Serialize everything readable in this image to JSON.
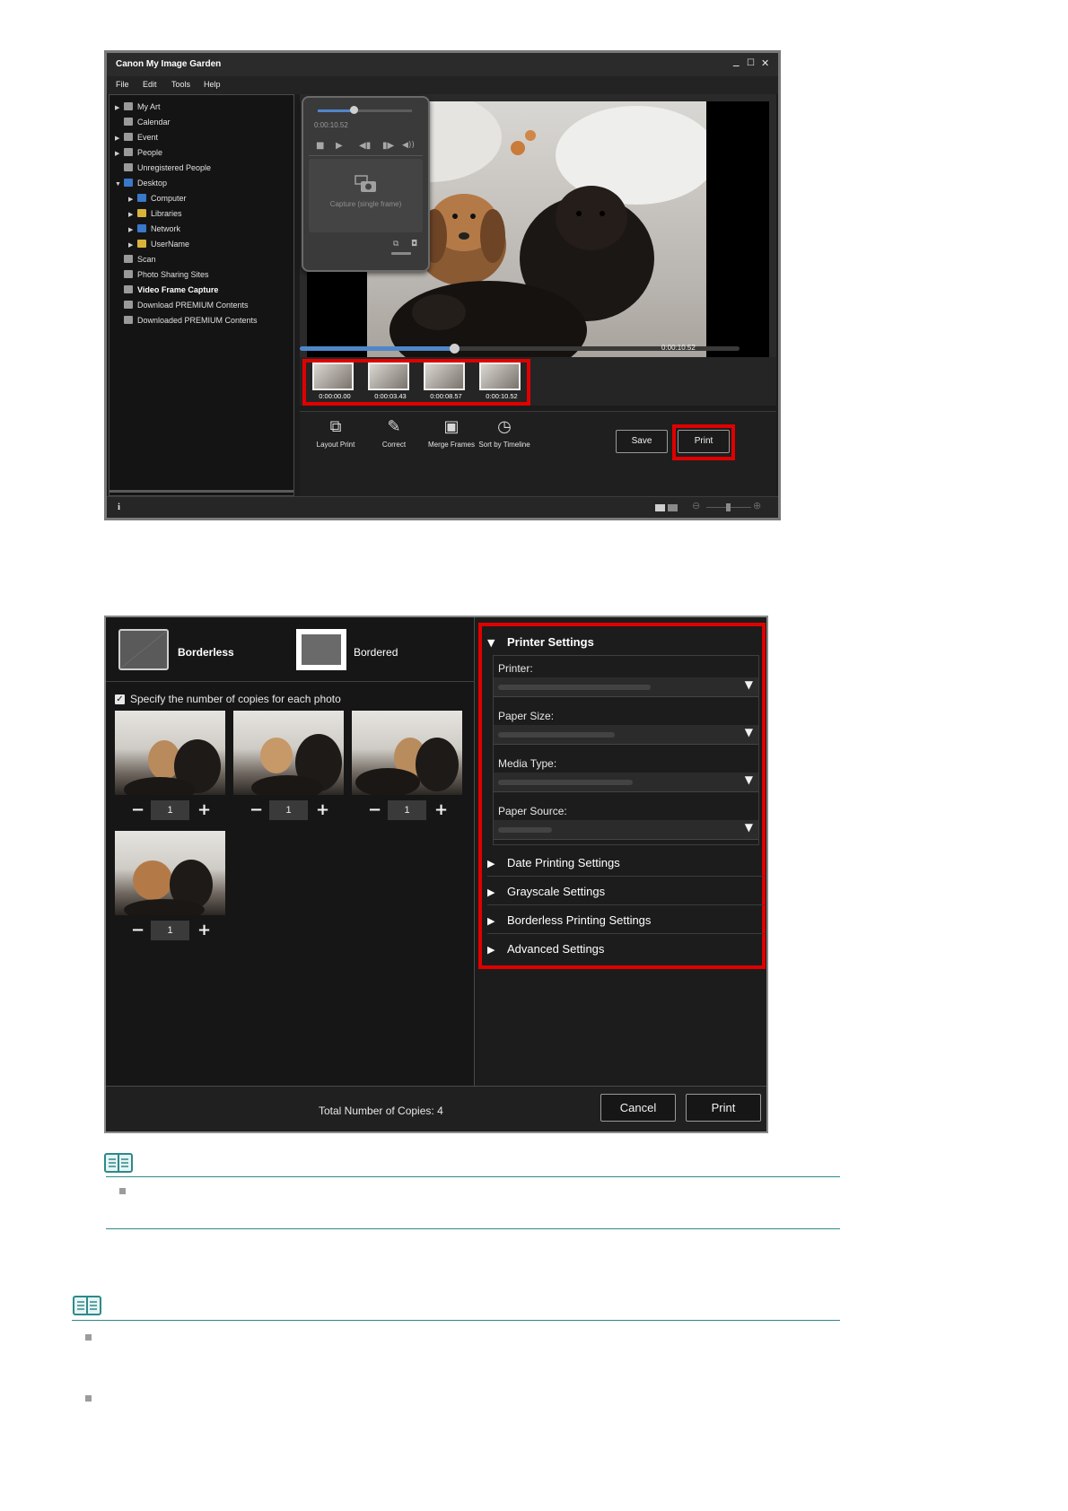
{
  "window1": {
    "title": "Canon My Image Garden",
    "window_controls": [
      "_",
      "☐",
      "✕"
    ],
    "menu": [
      "File",
      "Edit",
      "Tools",
      "Help"
    ],
    "sidebar": [
      {
        "label": "My Art",
        "expandable": true,
        "indent": 0,
        "icon": "my-art-icon"
      },
      {
        "label": "Calendar",
        "expandable": false,
        "indent": 0,
        "icon": "calendar-icon"
      },
      {
        "label": "Event",
        "expandable": true,
        "indent": 0,
        "icon": "event-icon"
      },
      {
        "label": "People",
        "expandable": true,
        "indent": 0,
        "icon": "people-icon"
      },
      {
        "label": "Unregistered People",
        "expandable": false,
        "indent": 0,
        "icon": "unregistered-people-icon"
      },
      {
        "label": "Desktop",
        "expandable": true,
        "expanded": true,
        "indent": 0,
        "icon": "desktop-icon",
        "color": "#3a78c8"
      },
      {
        "label": "Computer",
        "expandable": true,
        "indent": 1,
        "icon": "computer-icon",
        "color": "#3a78c8"
      },
      {
        "label": "Libraries",
        "expandable": true,
        "indent": 1,
        "icon": "libraries-icon",
        "color": "#d9b23a"
      },
      {
        "label": "Network",
        "expandable": true,
        "indent": 1,
        "icon": "network-icon",
        "color": "#3a78c8"
      },
      {
        "label": "UserName",
        "expandable": true,
        "indent": 1,
        "icon": "user-folder-icon",
        "color": "#d9b23a"
      },
      {
        "label": "Scan",
        "expandable": false,
        "indent": 0,
        "icon": "scan-icon"
      },
      {
        "label": "Photo Sharing Sites",
        "expandable": false,
        "indent": 0,
        "icon": "photo-sharing-icon"
      },
      {
        "label": "Video Frame Capture",
        "expandable": false,
        "indent": 0,
        "icon": "video-frame-capture-icon",
        "selected": true
      },
      {
        "label": "Download PREMIUM Contents",
        "expandable": false,
        "indent": 0,
        "icon": "download-premium-icon"
      },
      {
        "label": "Downloaded PREMIUM Contents",
        "expandable": false,
        "indent": 0,
        "icon": "downloaded-premium-icon"
      }
    ],
    "capture_popup": {
      "time": "0:00:10.52",
      "capture_label": "Capture (single frame)",
      "slider_fraction": 0.38
    },
    "playback_time": "0:00:10.52",
    "playback_fraction": 0.35,
    "thumbnails": [
      "0:00:00.00",
      "0:00:03.43",
      "0:00:08.57",
      "0:00:10.52"
    ],
    "tools": [
      {
        "label": "Layout Print",
        "icon": "layout-print-icon"
      },
      {
        "label": "Correct",
        "icon": "correct-icon"
      },
      {
        "label": "Merge Frames",
        "icon": "merge-frames-icon"
      },
      {
        "label": "Sort by Timeline",
        "icon": "sort-by-timeline-icon"
      }
    ],
    "save_label": "Save",
    "print_label": "Print",
    "status_info": "i",
    "highlight_color": "#e00000"
  },
  "window2": {
    "layout_options": [
      {
        "label": "Borderless",
        "selected": true
      },
      {
        "label": "Bordered",
        "selected": false
      }
    ],
    "copies_checkbox_label": "Specify the number of copies for each photo",
    "copies_checkbox_checked": true,
    "photos": [
      {
        "copies": "1"
      },
      {
        "copies": "1"
      },
      {
        "copies": "1"
      },
      {
        "copies": "1"
      }
    ],
    "minus_symbol": "−",
    "plus_symbol": "+",
    "printer_settings": {
      "title": "Printer Settings",
      "fields": [
        {
          "label": "Printer:"
        },
        {
          "label": "Paper Size:"
        },
        {
          "label": "Media Type:"
        },
        {
          "label": "Paper Source:"
        }
      ]
    },
    "collapsed_sections": [
      "Date Printing Settings",
      "Grayscale Settings",
      "Borderless Printing Settings",
      "Advanced Settings"
    ],
    "total_copies_label": "Total Number of Copies:",
    "total_copies_value": "4",
    "cancel_label": "Cancel",
    "print_label": "Print"
  }
}
